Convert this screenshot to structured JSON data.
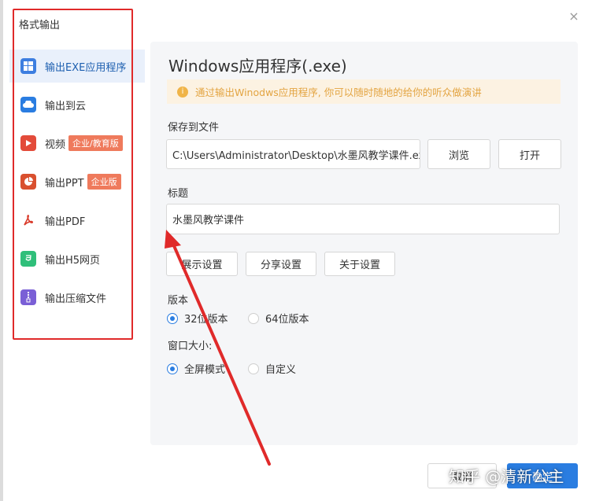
{
  "dialog": {
    "title": "格式输出",
    "close_label": "×"
  },
  "sidebar": {
    "items": [
      {
        "label": "输出EXE应用程序",
        "icon": "windows-icon",
        "color": "#3d7ee0",
        "active": true
      },
      {
        "label": "输出到云",
        "icon": "cloud-icon",
        "color": "#2a7de1"
      },
      {
        "label": "视频",
        "icon": "video-icon",
        "color": "#e34b3a",
        "badge": "企业/教育版"
      },
      {
        "label": "输出PPT",
        "icon": "ppt-icon",
        "color": "#d9502f",
        "badge": "企业版"
      },
      {
        "label": "输出PDF",
        "icon": "pdf-icon",
        "color": "#d93b2b"
      },
      {
        "label": "输出H5网页",
        "icon": "html5-icon",
        "color": "#2fbf7a"
      },
      {
        "label": "输出压缩文件",
        "icon": "zip-icon",
        "color": "#7a5fd6"
      }
    ]
  },
  "panel": {
    "title": "Windows应用程序(.exe)",
    "notice": "通过输出Winodws应用程序, 你可以随时随地的给你的听众做演讲",
    "save_label": "保存到文件",
    "save_path": "C:\\Users\\Administrator\\Desktop\\水墨风教学课件.exe",
    "browse_label": "浏览",
    "open_label": "打开",
    "title_label": "标题",
    "title_value": "水墨风教学课件",
    "buttons": {
      "display": "展示设置",
      "share": "分享设置",
      "about": "关于设置"
    },
    "version_label": "版本",
    "version_options": [
      "32位版本",
      "64位版本"
    ],
    "version_selected": "32位版本",
    "window_label": "窗口大小:",
    "window_options": [
      "全屏模式",
      "自定义"
    ],
    "window_selected": "全屏模式"
  },
  "footer": {
    "cancel_label": "取消",
    "ok_label": "确定"
  },
  "watermark": "知乎 @清新公主",
  "colors": {
    "accent": "#2a7de1",
    "annotation": "#e02a2a",
    "notice_bg": "#fcf2e2",
    "notice_text": "#e3a441"
  }
}
